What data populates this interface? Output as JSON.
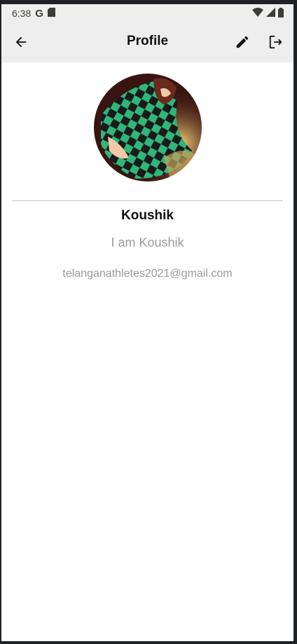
{
  "status_bar": {
    "time": "6:38",
    "icons": [
      "google-icon",
      "sd-card-icon",
      "wifi-icon",
      "signal-icon",
      "battery-icon"
    ]
  },
  "app_bar": {
    "title": "Profile",
    "icons": [
      "back-arrow-icon",
      "edit-pencil-icon",
      "logout-icon"
    ]
  },
  "profile": {
    "name": "Koushik",
    "bio": "I am Koushik",
    "email": "telanganathletes2021@gmail.com"
  },
  "colors": {
    "app_bar_bg": "#eeeeee",
    "text_primary": "#111111",
    "text_secondary": "#9a9a9a",
    "avatar_green": "#2fb67a",
    "avatar_dark": "#1a1a1a"
  }
}
